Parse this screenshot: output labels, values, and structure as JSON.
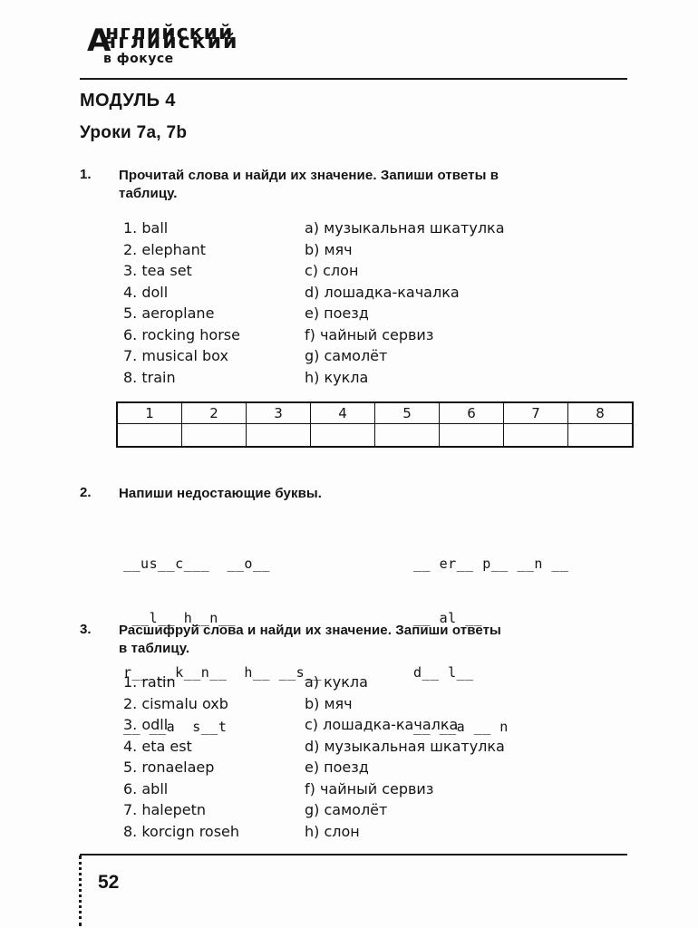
{
  "logo": {
    "big_letter": "А",
    "line1": "нглийский",
    "line1_overlay": "нглийский",
    "line2": "в фокусе"
  },
  "header": {
    "module_title": "МОДУЛЬ 4",
    "lesson_title": "Уроки 7a, 7b"
  },
  "exercise1": {
    "number": "1.",
    "instruction": "Прочитай слова и найди их значение. Запиши ответы в\nтаблицу.",
    "left_items": [
      "1. ball",
      "2. elephant",
      "3. tea set",
      "4. doll",
      "5. aeroplane",
      "6. rocking horse",
      "7. musical box",
      "8. train"
    ],
    "right_items": [
      "a) музыкальная шкатулка",
      "b) мяч",
      "c) слон",
      "d) лошадка-качалка",
      "e) поезд",
      "f) чайный сервиз",
      "g) самолёт",
      "h) кукла"
    ],
    "table_headers": [
      "1",
      "2",
      "3",
      "4",
      "5",
      "6",
      "7",
      "8"
    ],
    "table_answers": [
      "",
      "",
      "",
      "",
      "",
      "",
      "",
      ""
    ]
  },
  "exercise2": {
    "number": "2.",
    "instruction": "Напиши недостающие буквы.",
    "left_lines": [
      "__us__c___  __o__",
      " __l__ h__n__",
      "r__ __k__n__  h__ __s__",
      "__ __a  s__t"
    ],
    "right_lines": [
      "__ er__ p__ __n __",
      "__ al __",
      "d__ l__",
      "__ __a __ n"
    ]
  },
  "exercise3": {
    "number": "3.",
    "instruction": "Расшифруй слова и найди их значение. Запиши ответы\nв таблицу.",
    "left_items": [
      "1. ratin",
      "2. cismalu oxb",
      "3. odll",
      "4. eta est",
      "5. ronaelaep",
      "6. abll",
      "7. halepetn",
      "8. korcign roseh"
    ],
    "right_items": [
      "a) кукла",
      "b) мяч",
      "c) лошадка-качалка",
      "d) музыкальная шкатулка",
      "e) поезд",
      "f) чайный сервиз",
      "g) самолёт",
      "h) слон"
    ]
  },
  "footer": {
    "page_number": "52"
  }
}
